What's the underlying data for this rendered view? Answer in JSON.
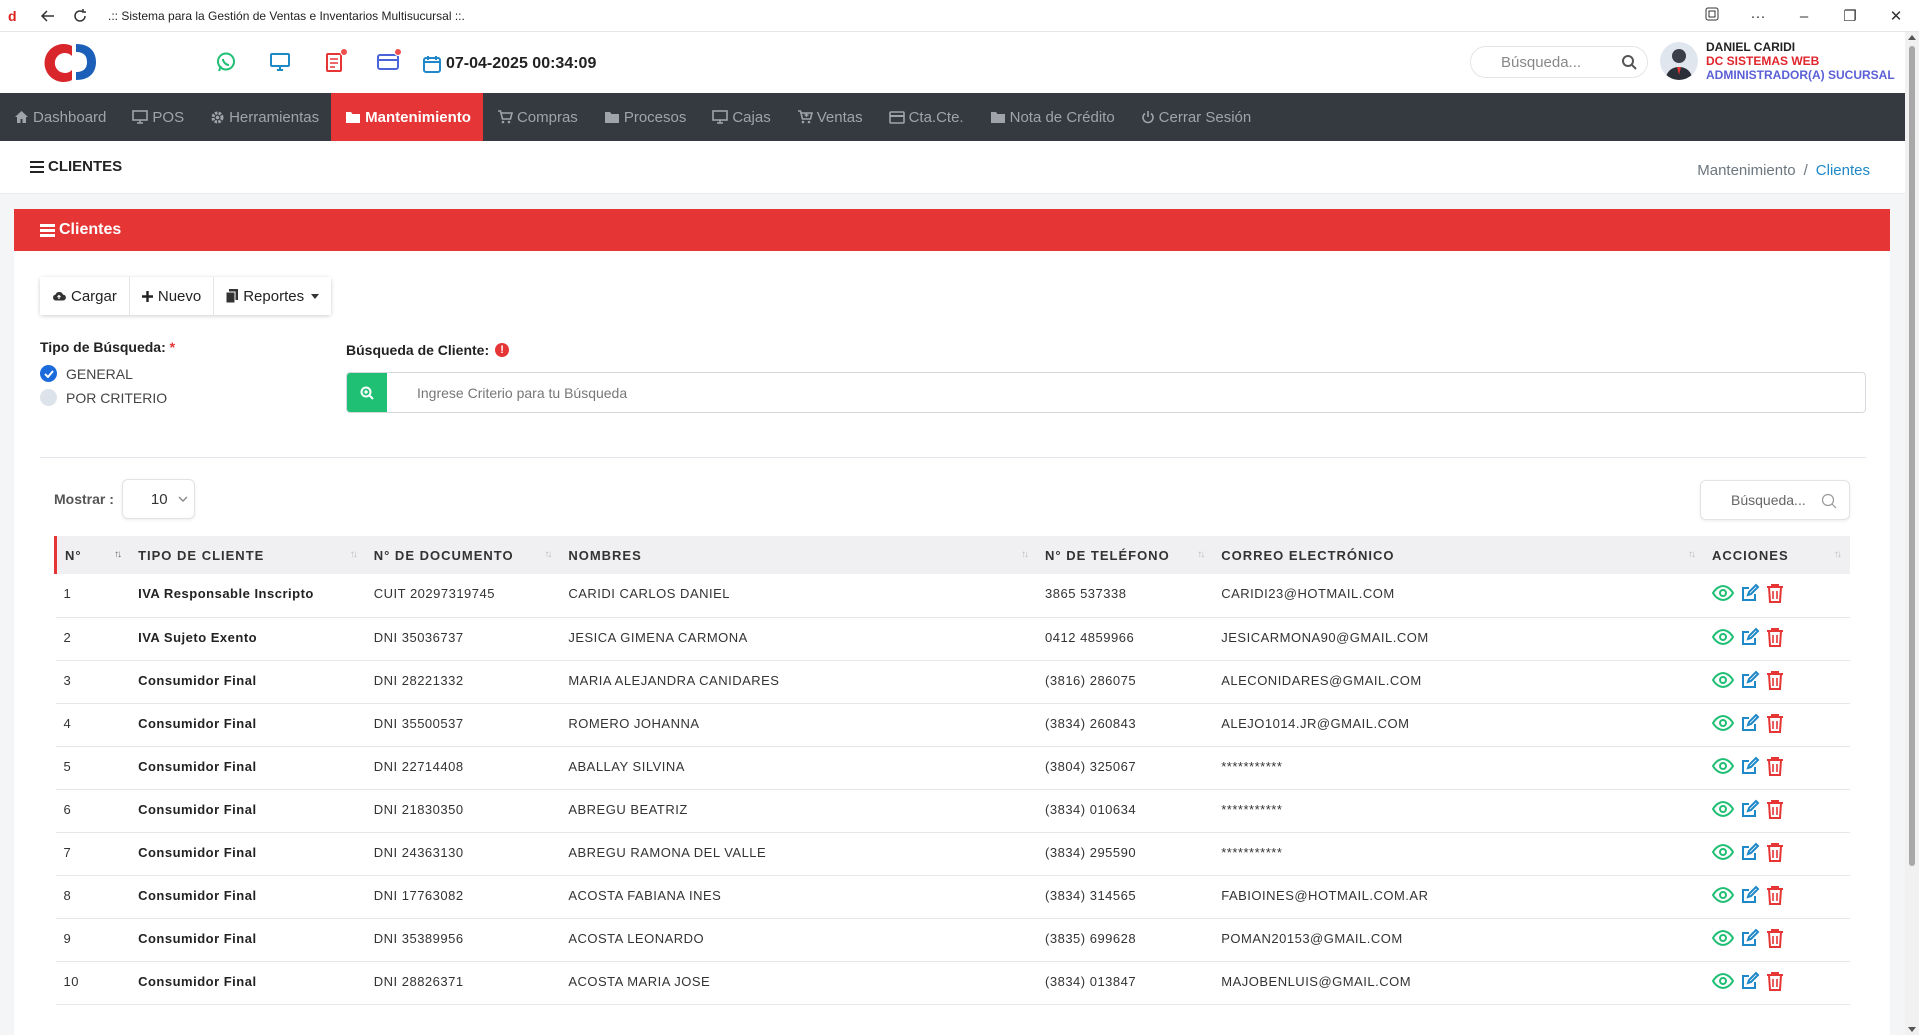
{
  "browser": {
    "title": ".:: Sistema para la Gestión de Ventas e Inventarios Multisucursal ::."
  },
  "header": {
    "datetime": "07-04-2025 00:34:09",
    "search_placeholder": "Búsqueda...",
    "user": {
      "name": "DANIEL CARIDI",
      "company": "DC SISTEMAS WEB",
      "role": "ADMINISTRADOR(A) SUCURSAL"
    }
  },
  "nav": [
    {
      "label": "Dashboard",
      "icon": "home-icon"
    },
    {
      "label": "POS",
      "icon": "monitor-icon"
    },
    {
      "label": "Herramientas",
      "icon": "gear-icon"
    },
    {
      "label": "Mantenimiento",
      "icon": "folder-icon",
      "active": true
    },
    {
      "label": "Compras",
      "icon": "cart-icon"
    },
    {
      "label": "Procesos",
      "icon": "folder-icon"
    },
    {
      "label": "Cajas",
      "icon": "desktop-icon"
    },
    {
      "label": "Ventas",
      "icon": "cart-plus-icon"
    },
    {
      "label": "Cta.Cte.",
      "icon": "credit-card-icon"
    },
    {
      "label": "Nota de Crédito",
      "icon": "folder-icon"
    },
    {
      "label": "Cerrar Sesión",
      "icon": "power-icon"
    }
  ],
  "page": {
    "title": "CLIENTES",
    "breadcrumb": {
      "parent": "Mantenimiento",
      "separator": "/",
      "current": "Clientes"
    }
  },
  "card": {
    "title": "Clientes",
    "buttons": {
      "cargar": "Cargar",
      "nuevo": "Nuevo",
      "reportes": "Reportes"
    },
    "tipo_busqueda_label": "Tipo de Búsqueda:",
    "required_mark": "*",
    "radio_general": "GENERAL",
    "radio_criterio": "POR CRITERIO",
    "busqueda_cliente_label": "Búsqueda de Cliente:",
    "busqueda_placeholder": "Ingrese Criterio para tu Búsqueda"
  },
  "table_controls": {
    "mostrar_label": "Mostrar :",
    "page_size": "10",
    "search_placeholder": "Búsqueda..."
  },
  "table": {
    "columns": [
      "N°",
      "TIPO DE CLIENTE",
      "N° DE DOCUMENTO",
      "NOMBRES",
      "N° DE TELÉFONO",
      "CORREO ELECTRÓNICO",
      "ACCIONES"
    ],
    "rows": [
      [
        "1",
        "IVA Responsable Inscripto",
        "CUIT 20297319745",
        "CARIDI CARLOS DANIEL",
        "3865 537338",
        "CARIDI23@HOTMAIL.COM"
      ],
      [
        "2",
        "IVA Sujeto Exento",
        "DNI 35036737",
        "JESICA GIMENA CARMONA",
        "0412 4859966",
        "JESICARMONA90@GMAIL.COM"
      ],
      [
        "3",
        "Consumidor Final",
        "DNI 28221332",
        "MARIA ALEJANDRA CANIDARES",
        "(3816) 286075",
        "ALECONIDARES@GMAIL.COM"
      ],
      [
        "4",
        "Consumidor Final",
        "DNI 35500537",
        "ROMERO JOHANNA",
        "(3834) 260843",
        "ALEJO1014.JR@GMAIL.COM"
      ],
      [
        "5",
        "Consumidor Final",
        "DNI 22714408",
        "ABALLAY SILVINA",
        "(3804) 325067",
        "***********"
      ],
      [
        "6",
        "Consumidor Final",
        "DNI 21830350",
        "ABREGU BEATRIZ",
        "(3834) 010634",
        "***********"
      ],
      [
        "7",
        "Consumidor Final",
        "DNI 24363130",
        "ABREGU RAMONA DEL VALLE",
        "(3834) 295590",
        "***********"
      ],
      [
        "8",
        "Consumidor Final",
        "DNI 17763082",
        "ACOSTA FABIANA INES",
        "(3834) 314565",
        "FABIOINES@HOTMAIL.COM.AR"
      ],
      [
        "9",
        "Consumidor Final",
        "DNI 35389956",
        "ACOSTA LEONARDO",
        "(3835) 699628",
        "POMAN20153@GMAIL.COM"
      ],
      [
        "10",
        "Consumidor Final",
        "DNI 28826371",
        "ACOSTA MARIA JOSE",
        "(3834) 013847",
        "MAJOBENLUIS@GMAIL.COM"
      ]
    ]
  },
  "colors": {
    "accent_red": "#e53535",
    "navbar": "#343a40",
    "green": "#1fbf74",
    "edit_blue": "#1e88c8"
  }
}
